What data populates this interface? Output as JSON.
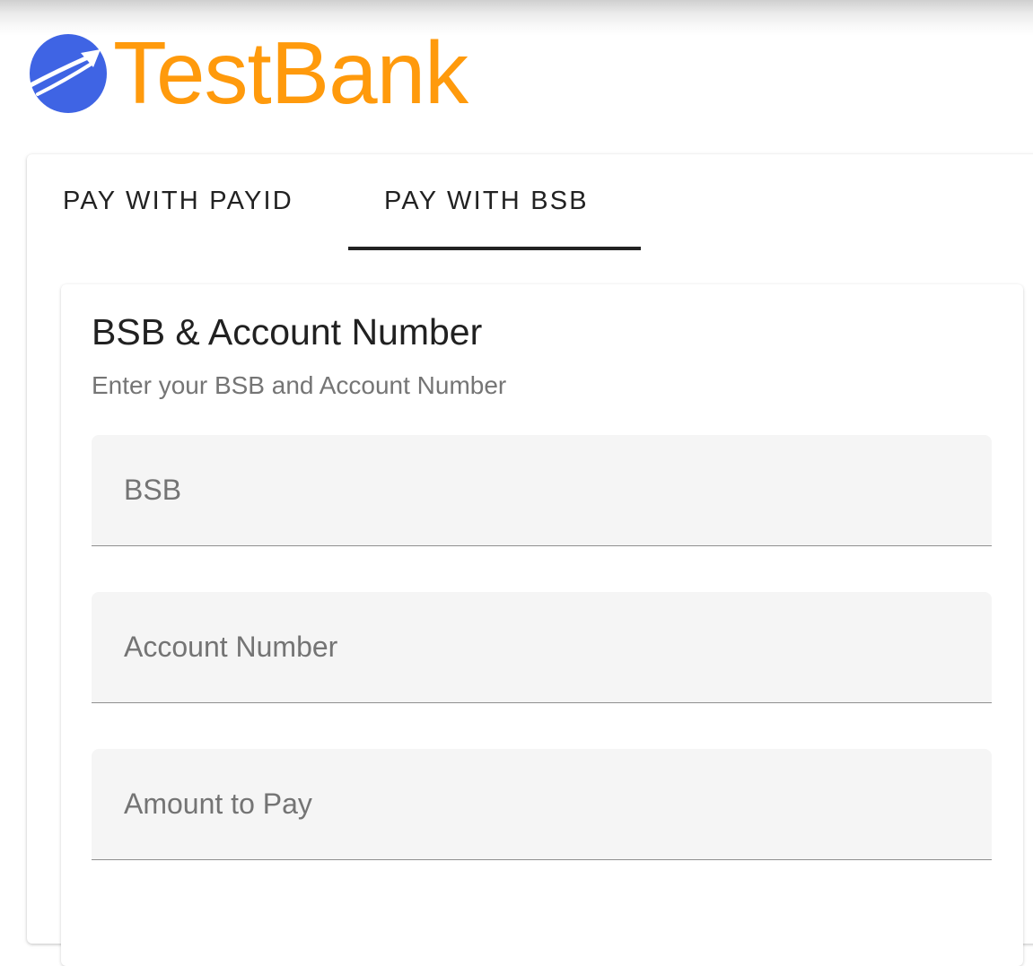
{
  "header": {
    "brand_name": "TestBank",
    "logo_icon": "paper-plane-globe-icon",
    "brand_color": "#ff9a0c",
    "logo_color": "#3f64e4"
  },
  "tabs": {
    "items": [
      {
        "label": "PAY WITH PAYID",
        "active": false
      },
      {
        "label": "PAY WITH BSB",
        "active": true
      }
    ]
  },
  "form": {
    "title": "BSB & Account Number",
    "subtitle": "Enter your BSB and Account Number",
    "fields": {
      "bsb": {
        "placeholder": "BSB",
        "value": ""
      },
      "account_number": {
        "placeholder": "Account Number",
        "value": ""
      },
      "amount": {
        "placeholder": "Amount to Pay",
        "value": ""
      }
    }
  }
}
